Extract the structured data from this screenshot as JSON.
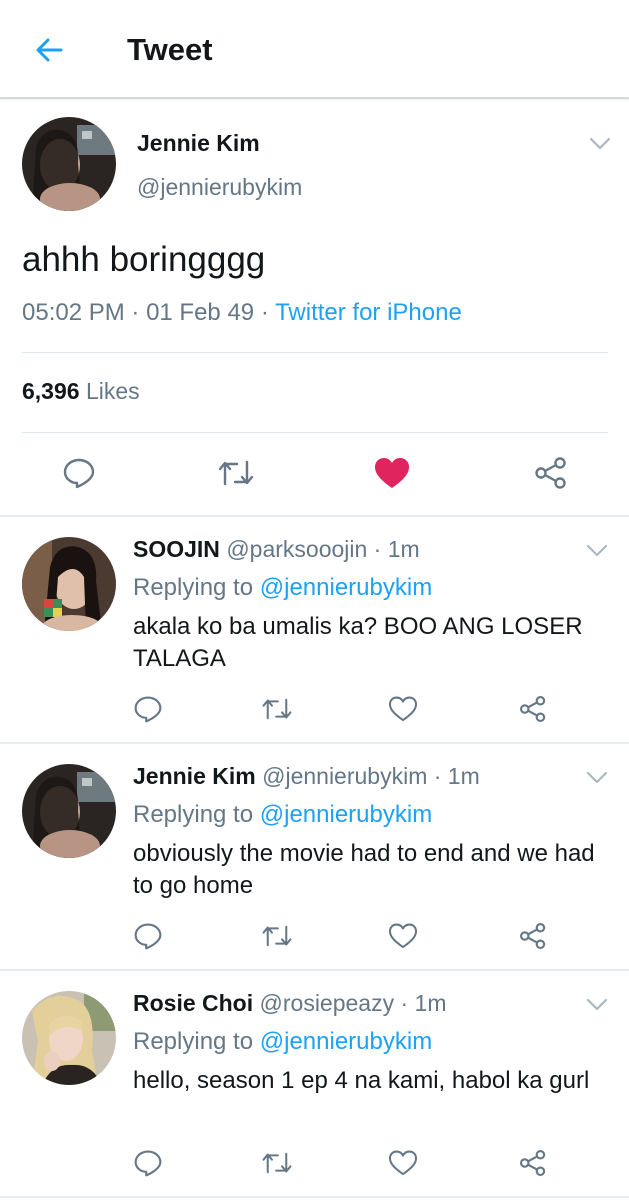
{
  "header": {
    "title": "Tweet",
    "back_icon": "arrow-left-icon",
    "accent": "#1da1f2"
  },
  "main_tweet": {
    "name": "Jennie Kim",
    "handle": "@jennierubykim",
    "text": "ahhh boringggg",
    "time": "05:02 PM",
    "sep1": " · ",
    "date": "01 Feb 49",
    "sep2": " · ",
    "source": "Twitter for iPhone",
    "likes_count": "6,396",
    "likes_label": "Likes",
    "liked": true,
    "like_color": "#e0245e"
  },
  "replies": [
    {
      "name": "SOOJIN",
      "handle": "@parksooojin",
      "time": " · 1m",
      "replying_label": "Replying to",
      "replying_to": "@jennierubykim",
      "text": "akala ko ba umalis ka? BOO ANG LOSER TALAGA"
    },
    {
      "name": "Jennie Kim",
      "handle": "@jennierubykim",
      "time": " · 1m",
      "replying_label": "Replying to",
      "replying_to": "@jennierubykim",
      "text": "obviously the movie had to end and we had to go home"
    },
    {
      "name": "Rosie Choi",
      "handle": "@rosiepeazy",
      "time": " · 1m",
      "replying_label": "Replying to",
      "replying_to": "@jennierubykim",
      "text": "hello, season 1 ep 4 na kami, habol ka gurl"
    }
  ]
}
